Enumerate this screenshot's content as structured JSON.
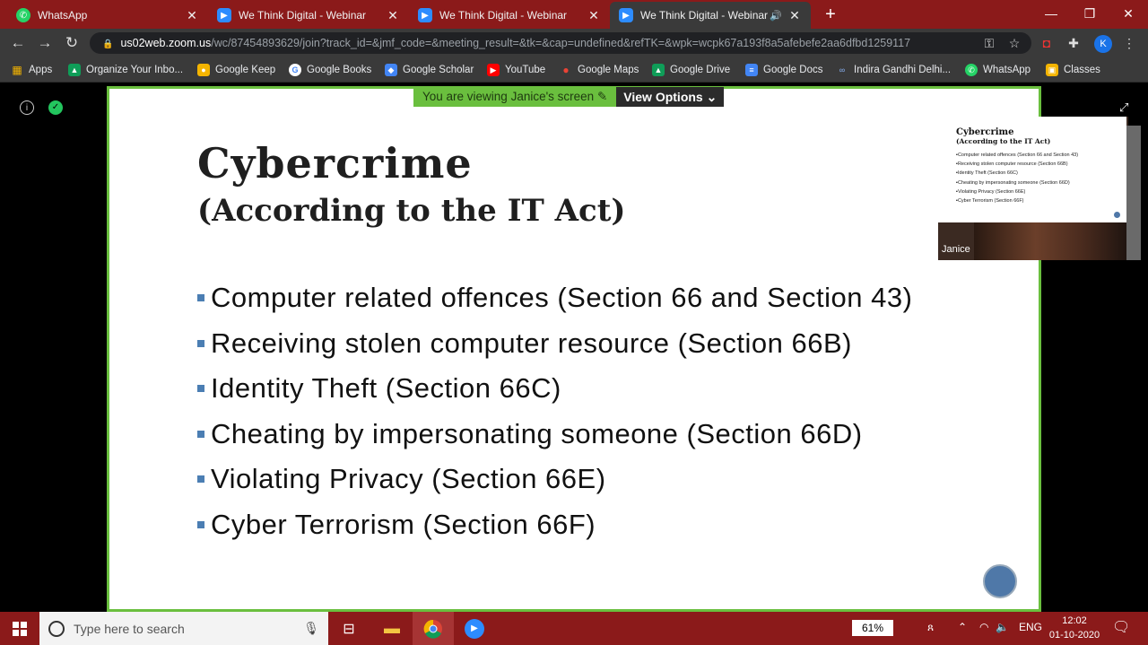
{
  "browser": {
    "tabs": [
      {
        "title": "WhatsApp",
        "icon": "whatsapp-icon"
      },
      {
        "title": "We Think Digital - Webinar",
        "icon": "zoom-icon"
      },
      {
        "title": "We Think Digital - Webinar",
        "icon": "zoom-icon"
      },
      {
        "title": "We Think Digital - Webinar",
        "icon": "zoom-icon",
        "active": true
      }
    ],
    "url_host": "us02web.zoom.us",
    "url_path": "/wc/87454893629/join?track_id=&jmf_code=&meeting_result=&tk=&cap=undefined&refTK=&wpk=wcpk67a193f8a5afebefe2aa6dfbd1259117",
    "profile_initial": "K",
    "bookmarks": [
      {
        "label": "Apps",
        "icon": "apps-grid-icon"
      },
      {
        "label": "Organize Your Inbo...",
        "icon": "drive-icon"
      },
      {
        "label": "Google Keep",
        "icon": "keep-icon"
      },
      {
        "label": "Google Books",
        "icon": "google-icon"
      },
      {
        "label": "Google Scholar",
        "icon": "scholar-icon"
      },
      {
        "label": "YouTube",
        "icon": "youtube-icon"
      },
      {
        "label": "Google Maps",
        "icon": "maps-icon"
      },
      {
        "label": "Google Drive",
        "icon": "drive-icon"
      },
      {
        "label": "Google Docs",
        "icon": "docs-icon"
      },
      {
        "label": "Indira Gandhi Delhi...",
        "icon": "link-icon"
      },
      {
        "label": "WhatsApp",
        "icon": "whatsapp-icon"
      },
      {
        "label": "Classes",
        "icon": "classroom-icon"
      }
    ]
  },
  "zoom": {
    "banner_text": "You are viewing Janice's screen",
    "view_options": "View Options",
    "participant_name": "Janice"
  },
  "slide": {
    "title": "Cybercrime",
    "subtitle": "(According to the IT Act)",
    "bullets": [
      "Computer related offences (Section 66 and Section 43)",
      "Receiving stolen computer resource (Section 66B)",
      "Identity Theft (Section 66C)",
      "Cheating by impersonating someone (Section 66D)",
      "Violating Privacy (Section 66E)",
      "Cyber Terrorism (Section 66F)"
    ]
  },
  "taskbar": {
    "search_placeholder": "Type here to search",
    "battery": "61%",
    "language": "ENG",
    "time": "12:02",
    "date": "01-10-2020"
  },
  "colors": {
    "titlebar": "#8b1a1a",
    "slide_border": "#6abf3e",
    "bullet": "#4b7eb3"
  }
}
